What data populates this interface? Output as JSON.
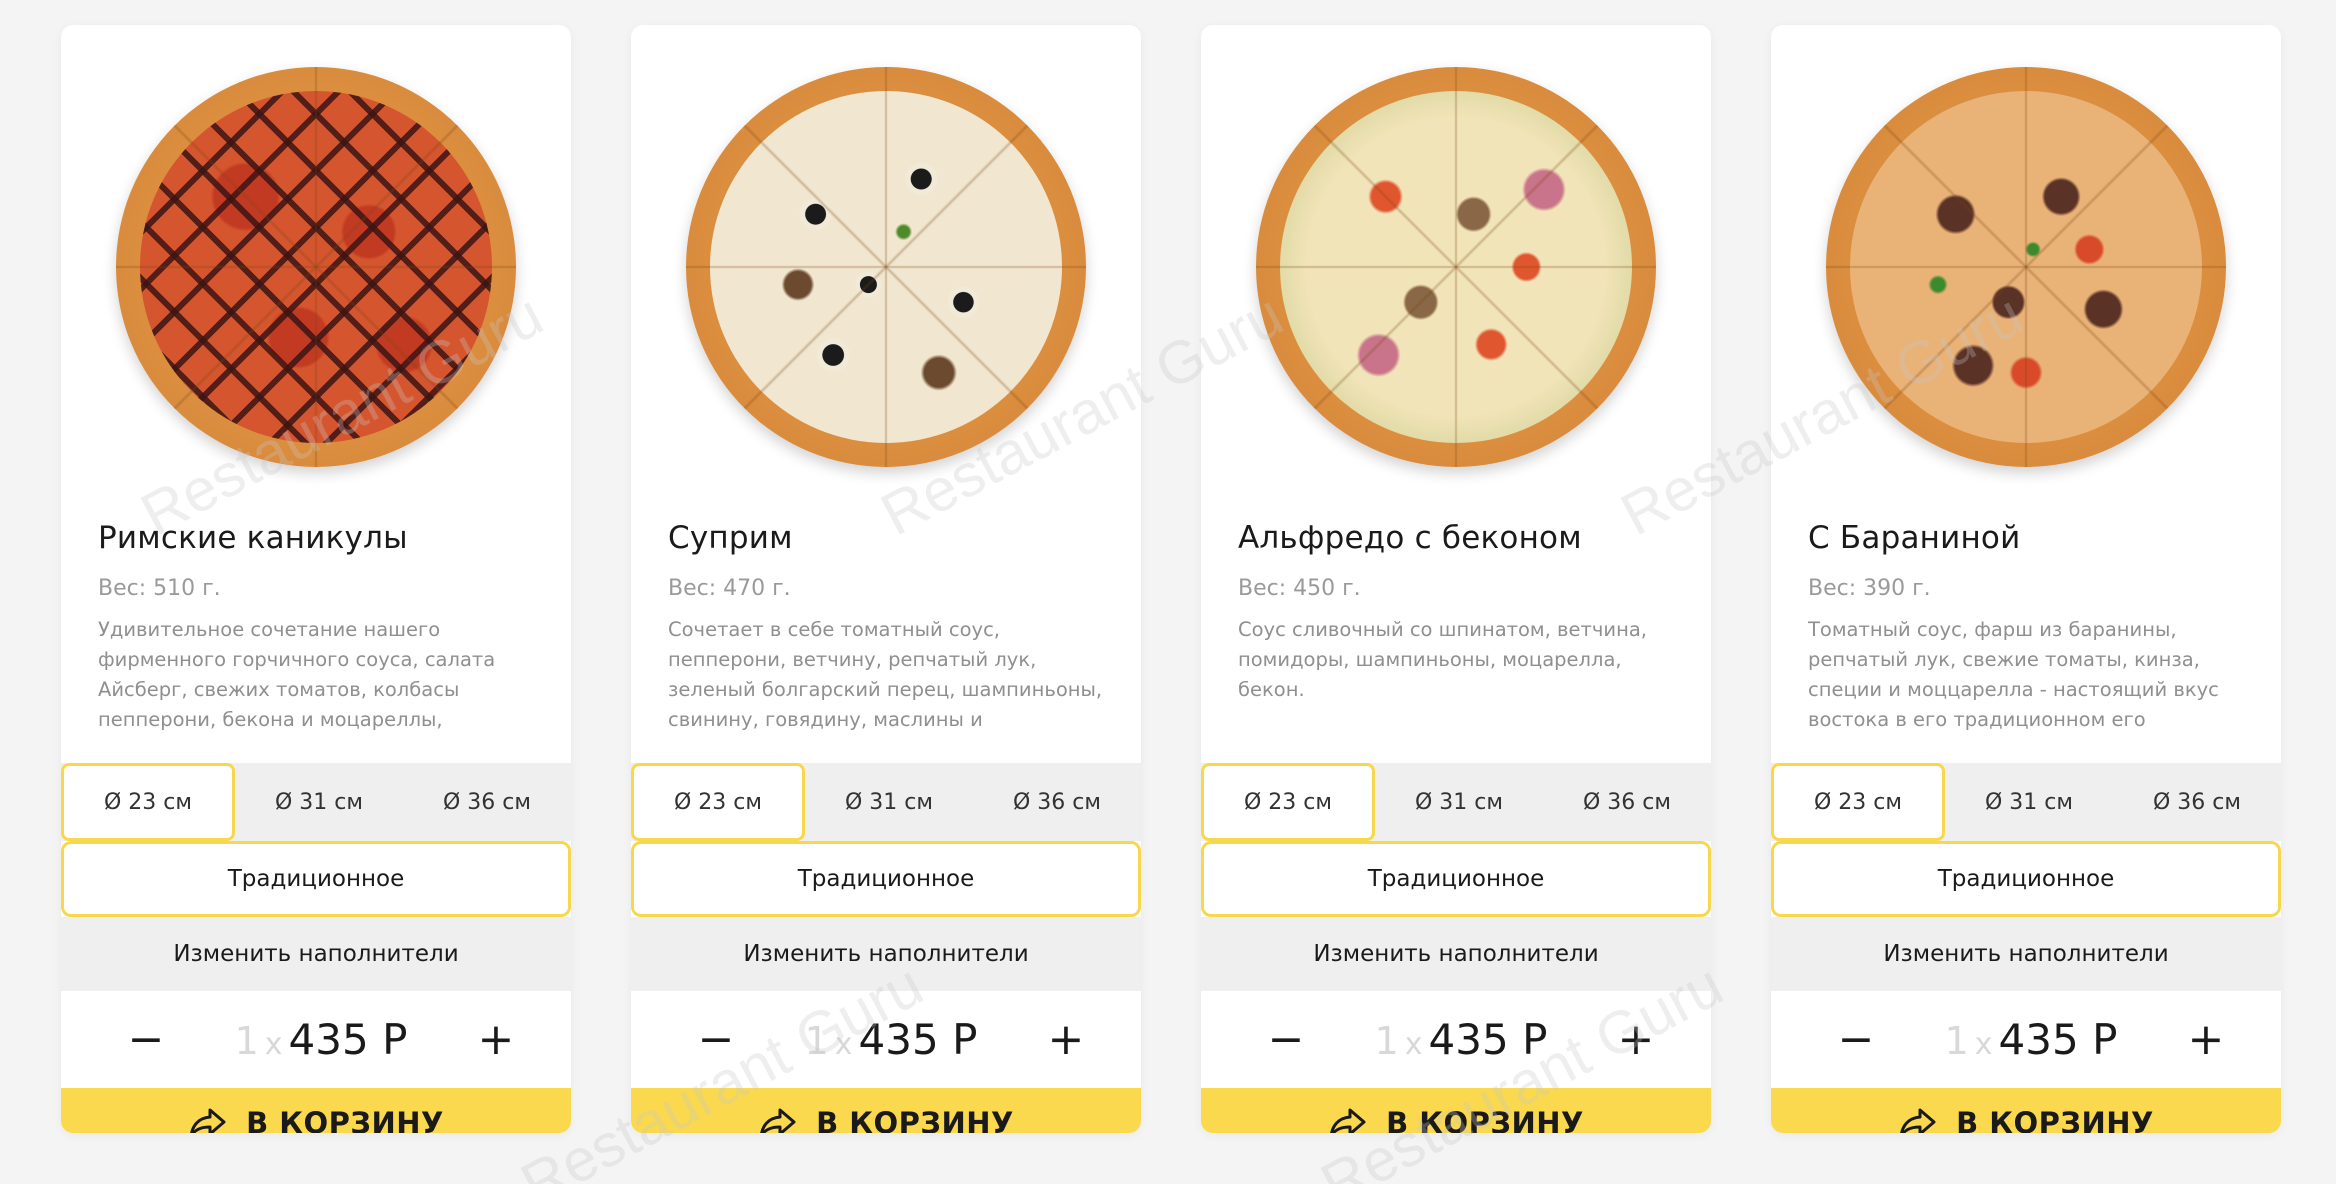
{
  "products": [
    {
      "title": "Римские каникулы",
      "weight": "Вес: 510 г.",
      "description": "Удивительное сочетание нашего фирменного горчичного соуса, салата Айсберг, свежих томатов, колбасы пепперони, бекона и моцареллы, заправленное бальзамическим соусом.",
      "sizes": [
        "Ø 23 см",
        "Ø 31 см",
        "Ø 36 см"
      ],
      "dough": "Традиционное",
      "toppings": "Изменить наполнители",
      "quantity": "1",
      "times": "x",
      "price": "435 Р",
      "cart": "В КОРЗИНУ"
    },
    {
      "title": "Суприм",
      "weight": "Вес: 470 г.",
      "description": "Сочетает в себе томатный соус, пепперони, ветчину, репчатый лук, зеленый болгарский перец, шампиньоны, свинину, говядину, маслины и моцарелла.",
      "sizes": [
        "Ø 23 см",
        "Ø 31 см",
        "Ø 36 см"
      ],
      "dough": "Традиционное",
      "toppings": "Изменить наполнители",
      "quantity": "1",
      "times": "x",
      "price": "435 Р",
      "cart": "В КОРЗИНУ"
    },
    {
      "title": "Альфредо с беконом",
      "weight": "Вес: 450 г.",
      "description": "Соус сливочный со шпинатом, ветчина, помидоры, шампиньоны, моцарелла, бекон.",
      "sizes": [
        "Ø 23 см",
        "Ø 31 см",
        "Ø 36 см"
      ],
      "dough": "Традиционное",
      "toppings": "Изменить наполнители",
      "quantity": "1",
      "times": "x",
      "price": "435 Р",
      "cart": "В КОРЗИНУ"
    },
    {
      "title": "С Бараниной",
      "weight": "Вес: 390 г.",
      "description": "Томатный соус, фарш из баранины, репчатый лук, свежие томаты, кинза, специи и моццарелла - настоящий вкус востока в его традиционном его исполнении.",
      "sizes": [
        "Ø 23 см",
        "Ø 31 см",
        "Ø 36 см"
      ],
      "dough": "Традиционное",
      "toppings": "Изменить наполнители",
      "quantity": "1",
      "times": "x",
      "price": "435 Р",
      "cart": "В КОРЗИНУ"
    }
  ],
  "icons": {
    "minus": "minus-icon",
    "plus": "plus-icon",
    "cart": "share-arrow-icon"
  },
  "colors": {
    "accent": "#fad94f",
    "selected_border": "#f7d84c",
    "muted_text": "#9a9a9a",
    "panel_gray": "#efefef"
  },
  "watermark": "Restaurant Guru"
}
